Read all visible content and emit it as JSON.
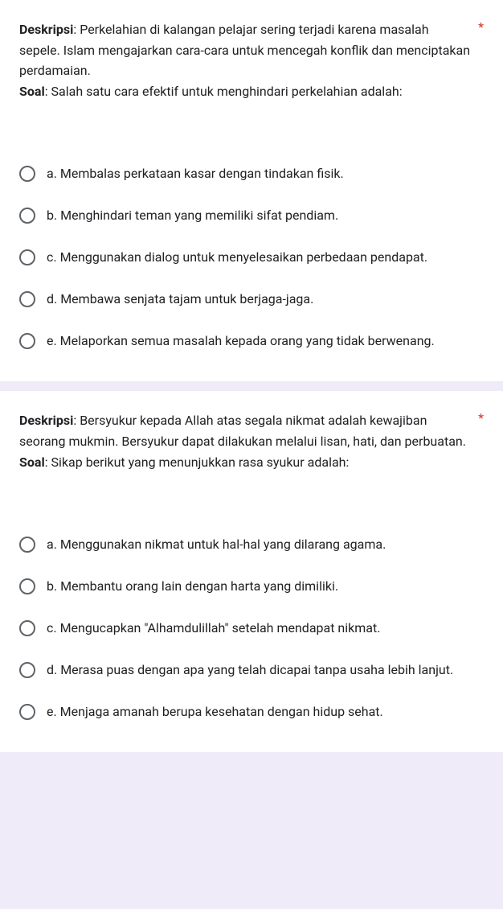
{
  "questions": [
    {
      "desc_label": "Deskripsi",
      "desc_text": ": Perkelahian di kalangan pelajar sering terjadi karena masalah sepele. Islam mengajarkan cara-cara untuk mencegah konflik dan menciptakan perdamaian.",
      "soal_label": "Soal",
      "soal_text": ": Salah satu cara efektif untuk menghindari perkelahian adalah:",
      "required": "*",
      "options": [
        "a. Membalas perkataan kasar dengan tindakan fisik.",
        "b. Menghindari teman yang memiliki sifat pendiam.",
        "c. Menggunakan dialog untuk menyelesaikan perbedaan pendapat.",
        "d. Membawa senjata tajam untuk berjaga-jaga.",
        "e. Melaporkan semua masalah kepada orang yang tidak berwenang."
      ]
    },
    {
      "desc_label": "Deskripsi",
      "desc_text": ": Bersyukur kepada Allah atas segala nikmat adalah kewajiban seorang mukmin. Bersyukur dapat dilakukan melalui lisan, hati, dan perbuatan.",
      "soal_label": "Soal",
      "soal_text": ": Sikap berikut yang menunjukkan rasa syukur adalah:",
      "required": "*",
      "options": [
        "a. Menggunakan nikmat untuk hal-hal yang dilarang agama.",
        "b. Membantu orang lain dengan harta yang dimiliki.",
        "c. Mengucapkan \"Alhamdulillah\" setelah mendapat nikmat.",
        "d. Merasa puas dengan apa yang telah dicapai tanpa usaha lebih lanjut.",
        "e. Menjaga amanah berupa kesehatan dengan hidup sehat."
      ]
    }
  ]
}
